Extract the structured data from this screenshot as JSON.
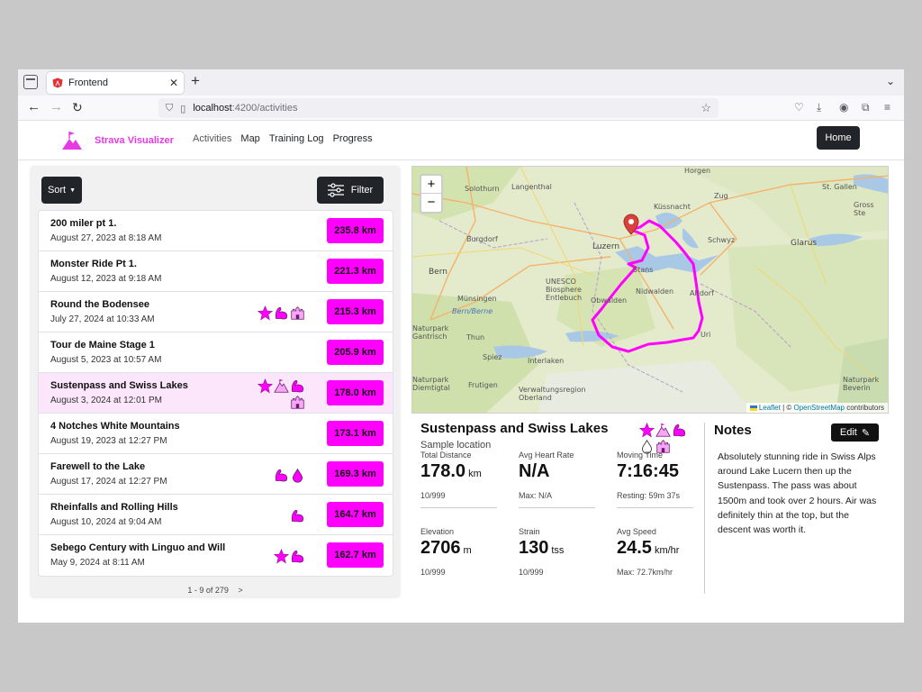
{
  "browser": {
    "tab_title": "Frontend",
    "url_host": "localhost",
    "url_path": ":4200/activities"
  },
  "app": {
    "brand": "Strava Visualizer",
    "nav": [
      "Activities",
      "Map",
      "Training Log",
      "Progress"
    ],
    "home_label": "Home",
    "brand_color": "#e83ae3"
  },
  "list": {
    "sort_label": "Sort",
    "filter_label": "Filter",
    "pager": "1 - 9 of 279",
    "pager_next": ">",
    "activities": [
      {
        "name": "200 miler pt 1.",
        "date": "August 27, 2023 at 8:18 AM",
        "distance": "235.8 km",
        "badges": []
      },
      {
        "name": "Monster Ride Pt 1.",
        "date": "August 12, 2023 at 9:18 AM",
        "distance": "221.3 km",
        "badges": []
      },
      {
        "name": "Round the Bodensee",
        "date": "July 27, 2024 at 10:33 AM",
        "distance": "215.3 km",
        "badges": [
          "star-icon",
          "muscle-icon",
          "castle-icon"
        ]
      },
      {
        "name": "Tour de Maine Stage 1",
        "date": "August 5, 2023 at 10:57 AM",
        "distance": "205.9 km",
        "badges": []
      },
      {
        "name": "Sustenpass and Swiss Lakes",
        "date": "August 3, 2024 at 12:01 PM",
        "distance": "178.0 km",
        "badges": [
          "star-icon",
          "mountain-icon",
          "muscle-icon",
          "castle-icon"
        ],
        "selected": true
      },
      {
        "name": "4 Notches White Mountains",
        "date": "August 19, 2023 at 12:27 PM",
        "distance": "173.1 km",
        "badges": []
      },
      {
        "name": "Farewell to the Lake",
        "date": "August 17, 2024 at 12:27 PM",
        "distance": "169.3 km",
        "badges": [
          "muscle-icon",
          "drop-icon"
        ]
      },
      {
        "name": "Rheinfalls and Rolling Hills",
        "date": "August 10, 2024 at 9:04 AM",
        "distance": "164.7 km",
        "badges": [
          "muscle-icon"
        ]
      },
      {
        "name": "Sebego Century with Linguo and Will",
        "date": "May 9, 2024 at 8:11 AM",
        "distance": "162.7 km",
        "badges": [
          "star-icon",
          "muscle-icon"
        ]
      }
    ]
  },
  "map": {
    "zoom_in": "+",
    "zoom_out": "−",
    "attribution_leaflet": "Leaflet",
    "attribution_sep": " | © ",
    "attribution_osm": "OpenStreetMap",
    "attribution_tail": " contributors",
    "route_color": "#ff00ff",
    "labels": {
      "solothurn": "Solothurn",
      "langenthal": "Langenthal",
      "zug": "Zug",
      "horgen": "Horgen",
      "burgdorf": "Burgdorf",
      "luzern": "Luzern",
      "schwyz": "Schwyz",
      "glarus": "Glarus",
      "stgallen": "St. Gallen",
      "bern": "Bern",
      "stans": "Stans",
      "nidwalden": "Nidwalden",
      "obwalden": "Obwalden",
      "unesco": "UNESCO Biosphere Entlebuch",
      "munsingen": "Münsingen",
      "bernbern": "Bern/Berne",
      "altdorf": "Altdorf",
      "uri": "Uri",
      "thun": "Thun",
      "spiez": "Spiez",
      "interlaken": "Interlaken",
      "frutigen": "Frutigen",
      "naturpark_gantrisch": "Naturpark Gantrisch",
      "naturpark_diemtigtal": "Naturpark Diemtigtal",
      "verwaltung": "Verwaltungsregion Oberland",
      "naturpark_beverin": "Naturpark Beverin",
      "grossste": "Gross Ste",
      "kussnacht": "Küssnacht"
    }
  },
  "details": {
    "title": "Sustenpass and Swiss Lakes",
    "location": "Sample location",
    "badges": [
      "star-icon",
      "mountain-icon",
      "muscle-icon",
      "drop-icon",
      "castle-icon"
    ],
    "stats": [
      {
        "label": "Total Distance",
        "value": "178.0",
        "unit": "km",
        "sub": "10/999"
      },
      {
        "label": "Avg Heart Rate",
        "value": "N/A",
        "unit": "",
        "sub": "Max: N/A"
      },
      {
        "label": "Moving Time",
        "value": "7:16:45",
        "unit": "",
        "sub": "Resting: 59m 37s"
      },
      {
        "label": "Elevation",
        "value": "2706",
        "unit": "m",
        "sub": "10/999"
      },
      {
        "label": "Strain",
        "value": "130",
        "unit": "tss",
        "sub": "10/999"
      },
      {
        "label": "Avg Speed",
        "value": "24.5",
        "unit": "km/hr",
        "sub": "Max: 72.7km/hr"
      }
    ]
  },
  "notes": {
    "title": "Notes",
    "edit_label": "Edit",
    "text": "Absolutely stunning ride in Swiss Alps around Lake Lucern then up the Sustenpass. The pass was about 1500m and took over 2 hours. Air was definitely thin at the top, but the descent was worth it."
  }
}
